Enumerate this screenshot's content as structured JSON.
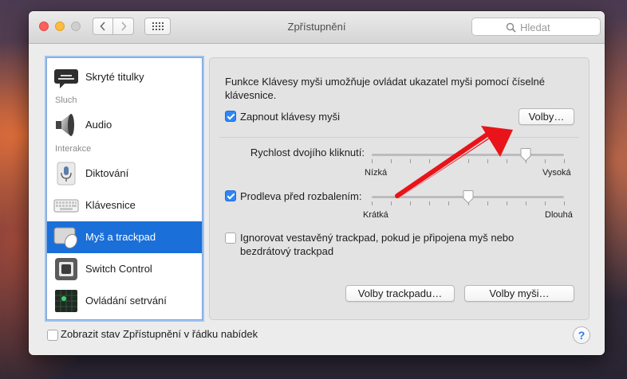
{
  "window": {
    "title": "Zpřístupnění",
    "search_placeholder": "Hledat"
  },
  "sidebar": {
    "items": [
      {
        "label": "Skryté titulky",
        "icon": "captions-icon"
      },
      {
        "label": "Audio",
        "icon": "speaker-icon"
      },
      {
        "label": "Diktování",
        "icon": "microphone-icon"
      },
      {
        "label": "Klávesnice",
        "icon": "keyboard-icon"
      },
      {
        "label": "Myš a trackpad",
        "icon": "mouse-trackpad-icon",
        "selected": true
      },
      {
        "label": "Switch Control",
        "icon": "switch-control-icon"
      },
      {
        "label": "Ovládání setrvání",
        "icon": "dwell-control-icon"
      }
    ],
    "headers": {
      "hearing": "Sluch",
      "interaction": "Interakce"
    }
  },
  "panel": {
    "description": "Funkce Klávesy myši umožňuje ovládat ukazatel myši pomocí číselné klávesnice.",
    "enable_mouse_keys": {
      "label": "Zapnout klávesy myši",
      "checked": true
    },
    "options_button": "Volby…",
    "double_click": {
      "label": "Rychlost dvojího kliknutí:",
      "min_label": "Nízká",
      "max_label": "Vysoká",
      "value": 0.8
    },
    "spring_delay": {
      "label": "Prodleva před rozbalením:",
      "checked": true,
      "min_label": "Krátká",
      "max_label": "Dlouhá",
      "value": 0.5
    },
    "ignore_trackpad": {
      "label": "Ignorovat vestavěný trackpad, pokud je připojena myš nebo bezdrátový trackpad",
      "checked": false
    },
    "trackpad_options_button": "Volby trackpadu…",
    "mouse_options_button": "Volby myši…"
  },
  "footer": {
    "show_status_label": "Zobrazit stav Zpřístupnění v řádku nabídek",
    "show_status_checked": false,
    "help": "?"
  },
  "colors": {
    "selection": "#1a6fd9",
    "checkbox_on": "#2f86f6",
    "annotation_arrow": "#e8141a"
  }
}
